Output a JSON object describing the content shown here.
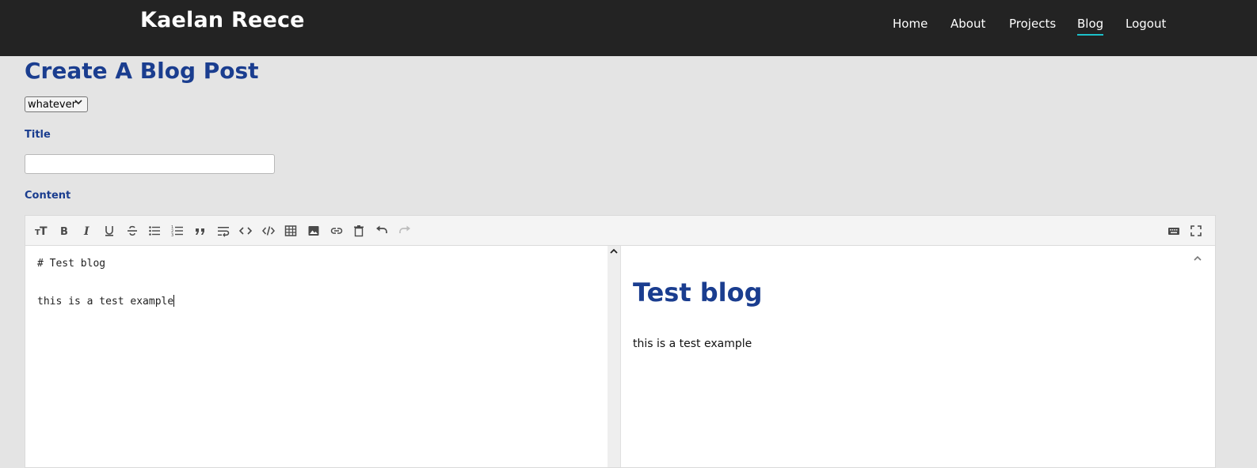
{
  "navbar": {
    "brand": "Kaelan Reece",
    "links": [
      {
        "label": "Home",
        "active": false
      },
      {
        "label": "About",
        "active": false
      },
      {
        "label": "Projects",
        "active": false
      },
      {
        "label": "Blog",
        "active": true
      },
      {
        "label": "Logout",
        "active": false
      }
    ],
    "active_underline_color": "#1cc0c9"
  },
  "page": {
    "title": "Create A Blog Post",
    "category_select": {
      "selected": "whatever"
    },
    "title_label": "Title",
    "title_input": {
      "value": "",
      "placeholder": ""
    },
    "content_label": "Content"
  },
  "editor": {
    "toolbar_left": [
      "heading-icon",
      "bold-icon",
      "italic-icon",
      "underline-icon",
      "strikethrough-icon",
      "unordered-list-icon",
      "ordered-list-icon",
      "quote-icon",
      "wrap-icon",
      "inline-code-icon",
      "code-block-icon",
      "table-icon",
      "image-icon",
      "link-icon",
      "clear-icon",
      "undo-icon",
      "redo-icon"
    ],
    "toolbar_right": [
      "keyboard-icon",
      "fullscreen-icon"
    ],
    "markdown_lines": [
      "# Test blog",
      "",
      "this is a test example"
    ],
    "preview": {
      "heading": "Test blog",
      "paragraph": "this is a test example"
    }
  },
  "colors": {
    "navbar_bg": "#232323",
    "page_bg": "#e4e4e4",
    "accent_blue": "#1a3d8f"
  }
}
